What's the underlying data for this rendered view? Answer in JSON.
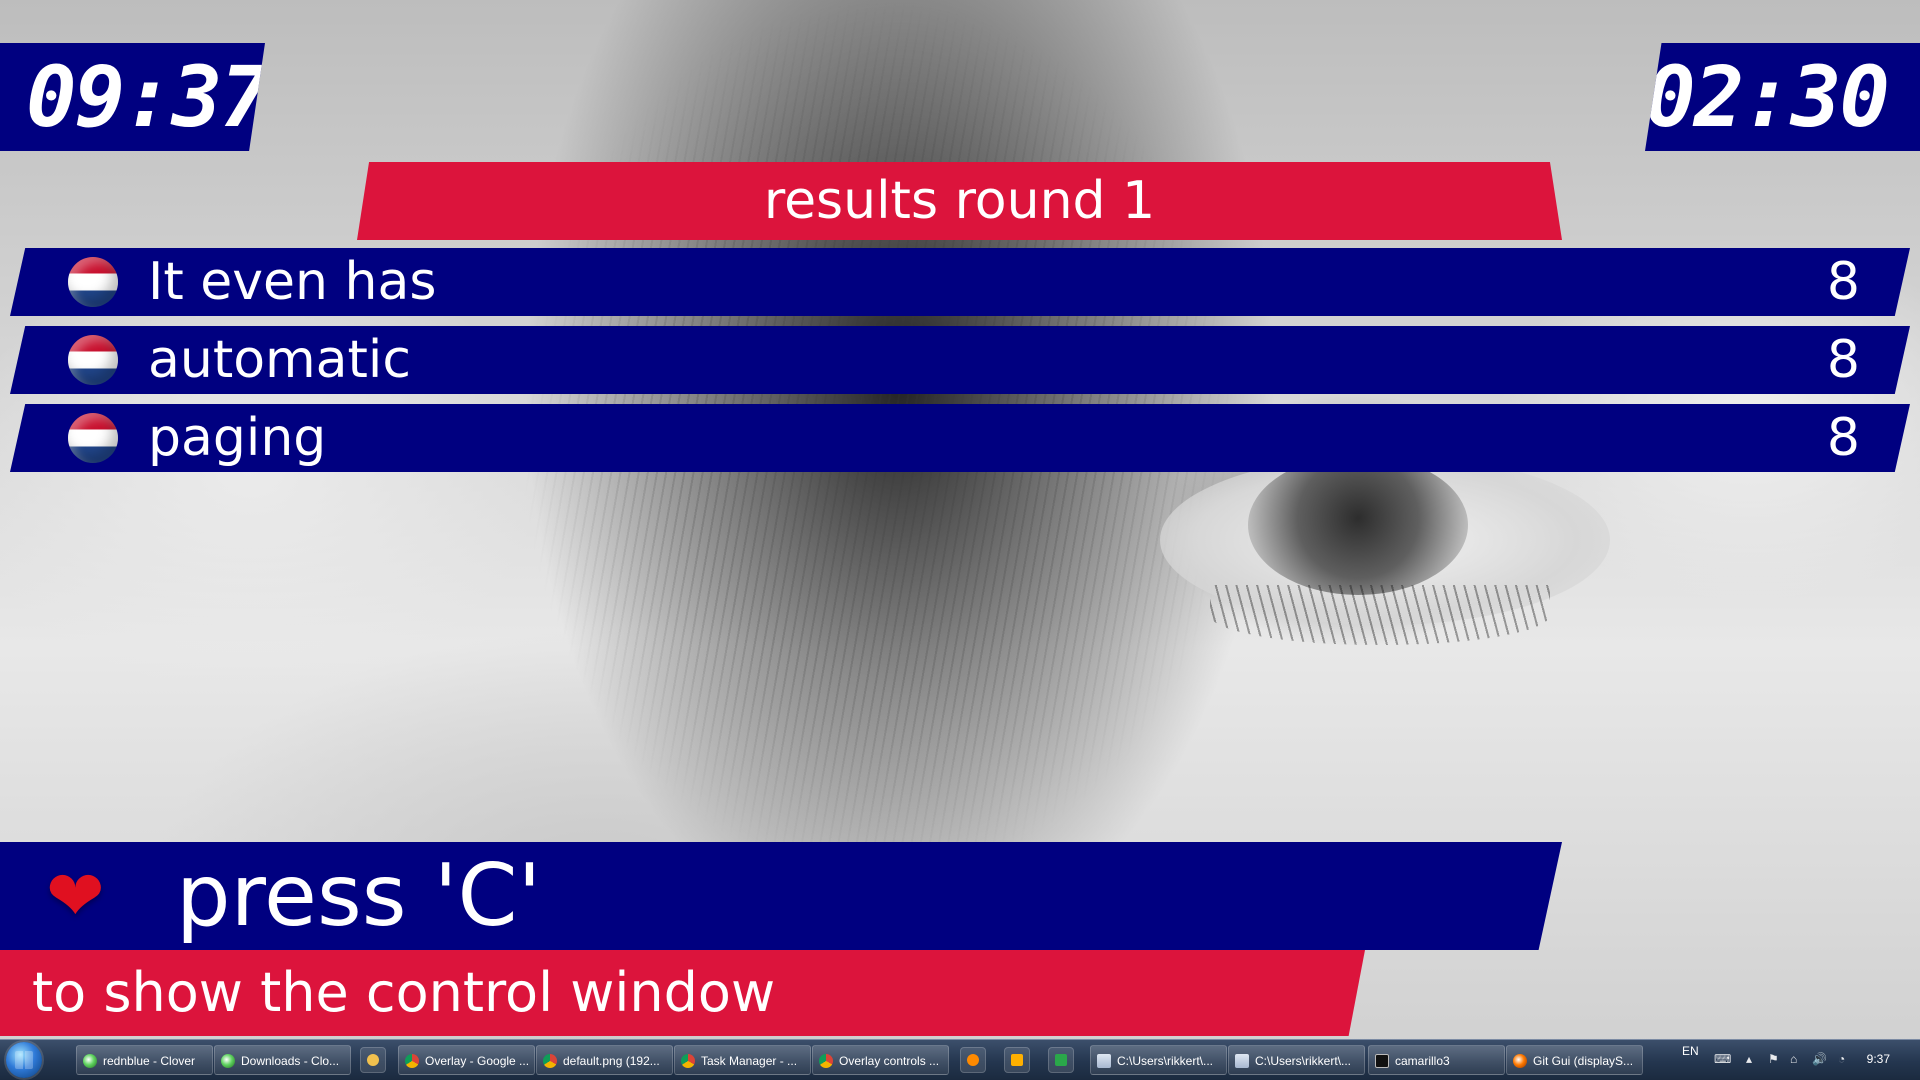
{
  "clocks": {
    "left": "09:37",
    "right": "02:30"
  },
  "round": {
    "title": "results round 1"
  },
  "results": [
    {
      "name": "It even has",
      "score": "8"
    },
    {
      "name": "automatic",
      "score": "8"
    },
    {
      "name": "paging",
      "score": "8"
    }
  ],
  "message": {
    "heart_glyph": "❤",
    "main": "press 'C'",
    "sub": "to show the control window"
  },
  "colors": {
    "navy": "#000080",
    "crimson": "#dc143c"
  },
  "taskbar": {
    "items": [
      {
        "label": "rednblue - Clover",
        "icon": "clover-icon"
      },
      {
        "label": "Downloads - Clo...",
        "icon": "clover-icon"
      },
      {
        "label": "Overlay - Google ...",
        "icon": "chrome-icon"
      },
      {
        "label": "default.png (192...",
        "icon": "chrome-icon"
      },
      {
        "label": "Task Manager - ...",
        "icon": "chrome-icon"
      },
      {
        "label": "Overlay controls ...",
        "icon": "chrome-icon"
      },
      {
        "label": "C:\\Users\\rikkert\\...",
        "icon": "app-icon"
      },
      {
        "label": "C:\\Users\\rikkert\\...",
        "icon": "app-icon"
      },
      {
        "label": "camarillo3",
        "icon": "terminal-icon"
      },
      {
        "label": "Git Gui (displayS...",
        "icon": "git-icon"
      }
    ],
    "tray": {
      "lang": "EN",
      "time": "9:37"
    }
  }
}
